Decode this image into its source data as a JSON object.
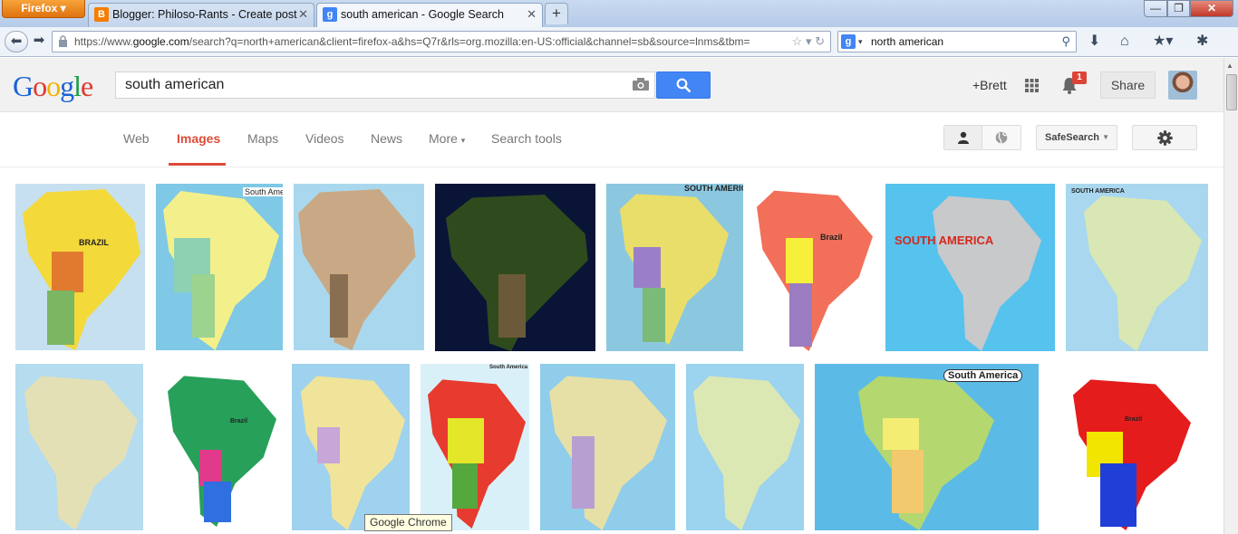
{
  "browser": {
    "app_button": "Firefox",
    "tabs": [
      {
        "label": "Blogger: Philoso-Rants - Create post",
        "icon": "blogger-icon"
      },
      {
        "label": "south american - Google Search",
        "icon": "google-icon"
      }
    ],
    "new_tab": "+",
    "url_scheme": "https://www.",
    "url_host": "google.com",
    "url_path": "/search?q=north+american&client=firefox-a&hs=Q7r&rls=org.mozilla:en-US:official&channel=sb&source=lnms&tbm=",
    "search_engine_letter": "g",
    "search_value": "north american"
  },
  "google": {
    "logo": [
      "G",
      "o",
      "o",
      "g",
      "l",
      "e"
    ],
    "query": "south american",
    "user": "+Brett",
    "notification_count": "1",
    "share_label": "Share"
  },
  "menu": {
    "items": [
      "Web",
      "Images",
      "Maps",
      "Videos",
      "News",
      "More",
      "Search tools"
    ],
    "active": "Images",
    "safesearch_label": "SafeSearch"
  },
  "images": {
    "row1": [
      {
        "caption": "BRAZIL"
      },
      {
        "caption": "South America"
      },
      {
        "caption": ""
      },
      {
        "caption": ""
      },
      {
        "caption": "SOUTH AMERICA"
      },
      {
        "caption": "Brazil"
      },
      {
        "caption": "SOUTH AMERICA"
      },
      {
        "caption": "SOUTH AMERICA"
      }
    ],
    "row2": [
      {
        "caption": ""
      },
      {
        "caption": "Brazil"
      },
      {
        "caption": ""
      },
      {
        "caption": "South America"
      },
      {
        "caption": ""
      },
      {
        "caption": ""
      },
      {
        "caption": "South America"
      },
      {
        "caption": "Brazil"
      }
    ]
  },
  "tooltip": "Google Chrome",
  "colors": {
    "accent_red": "#dd4b39",
    "google_blue": "#4285f4",
    "firefox_orange": "#e0720f"
  }
}
